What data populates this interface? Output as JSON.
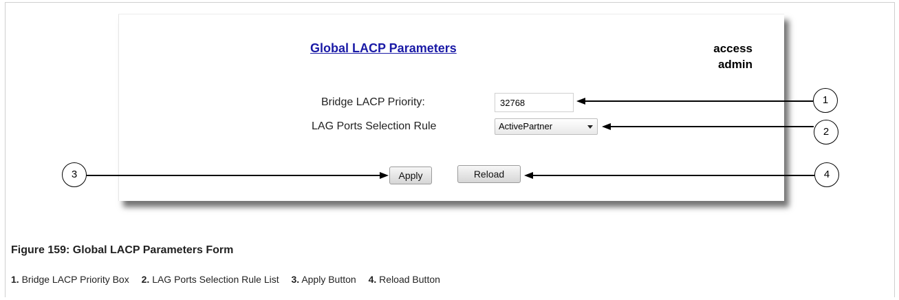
{
  "form": {
    "title": "Global LACP Parameters",
    "access_line1": "access",
    "access_line2": "admin",
    "priority_label": "Bridge LACP Priority:",
    "priority_value": "32768",
    "rule_label": "LAG Ports Selection Rule",
    "rule_selected": "ActivePartner",
    "apply_label": "Apply",
    "reload_label": "Reload"
  },
  "callouts": [
    "1",
    "2",
    "3",
    "4"
  ],
  "figure": {
    "caption": "Figure 159: Global LACP Parameters Form",
    "legend": [
      {
        "num": "1.",
        "text": "Bridge LACP Priority Box"
      },
      {
        "num": "2.",
        "text": "LAG Ports Selection Rule List"
      },
      {
        "num": "3.",
        "text": "Apply Button"
      },
      {
        "num": "4.",
        "text": "Reload Button"
      }
    ]
  }
}
